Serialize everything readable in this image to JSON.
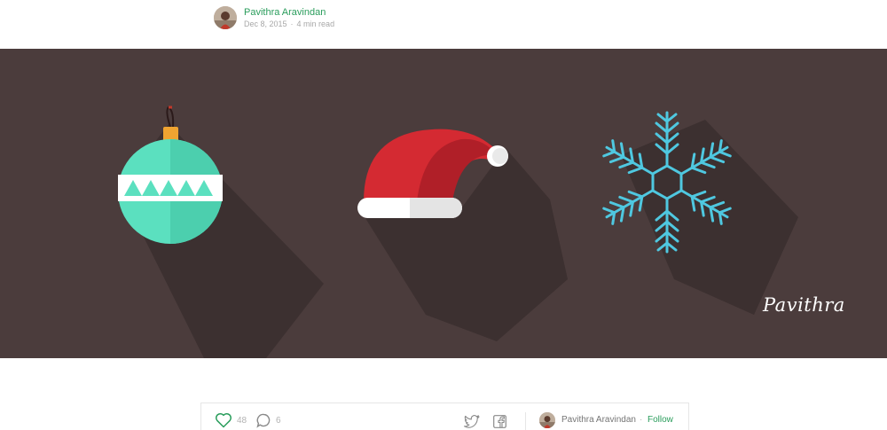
{
  "post": {
    "author": "Pavithra Aravindan",
    "date": "Dec 8, 2015",
    "read_time": "4 min read"
  },
  "banner": {
    "background_color": "#4b3c3c",
    "signature": "Pavithra",
    "illustrations": [
      "christmas-ornament-icon",
      "santa-hat-icon",
      "snowflake-icon"
    ]
  },
  "actions": {
    "recommend_count": "48",
    "response_count": "6",
    "author": "Pavithra Aravindan",
    "separator": "·",
    "follow_label": "Follow"
  },
  "colors": {
    "accent": "#2a9d5c",
    "ornament": "#5be0bf",
    "hat_red": "#d42a32",
    "snowflake": "#4fc8e0"
  }
}
